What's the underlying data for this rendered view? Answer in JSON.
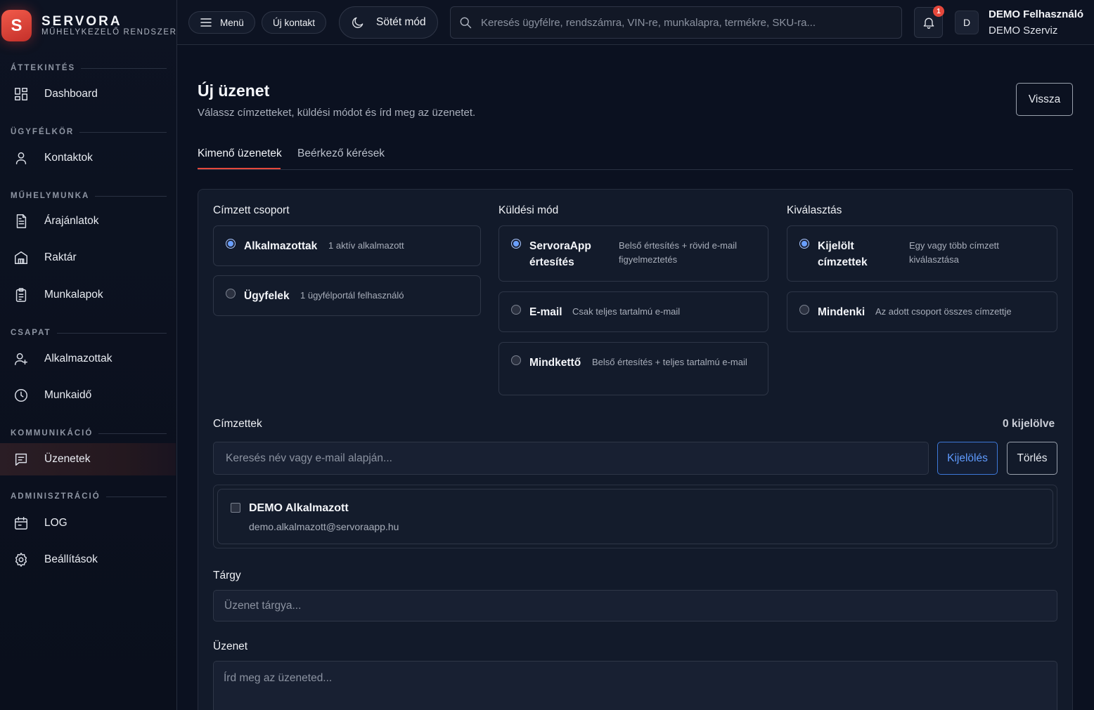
{
  "brand": {
    "logo_letter": "S",
    "name": "SERVORA",
    "subtitle": "MŰHELYKEZELŐ RENDSZER"
  },
  "sidebar": {
    "sections": [
      {
        "label": "ÁTTEKINTÉS",
        "items": [
          {
            "label": "Dashboard",
            "icon": "dashboard-icon"
          }
        ]
      },
      {
        "label": "ÜGYFÉLKÖR",
        "items": [
          {
            "label": "Kontaktok",
            "icon": "user-icon"
          }
        ]
      },
      {
        "label": "MŰHELYMUNKA",
        "items": [
          {
            "label": "Árajánlatok",
            "icon": "document-icon"
          },
          {
            "label": "Raktár",
            "icon": "warehouse-icon"
          },
          {
            "label": "Munkalapok",
            "icon": "clipboard-icon"
          }
        ]
      },
      {
        "label": "CSAPAT",
        "items": [
          {
            "label": "Alkalmazottak",
            "icon": "user-add-icon"
          },
          {
            "label": "Munkaidő",
            "icon": "clock-icon"
          }
        ]
      },
      {
        "label": "KOMMUNIKÁCIÓ",
        "items": [
          {
            "label": "Üzenetek",
            "icon": "message-icon",
            "active": true
          }
        ]
      },
      {
        "label": "ADMINISZTRÁCIÓ",
        "items": [
          {
            "label": "LOG",
            "icon": "calendar-icon"
          },
          {
            "label": "Beállítások",
            "icon": "gear-icon"
          }
        ]
      }
    ]
  },
  "topbar": {
    "menu_label": "Menü",
    "new_contact_label": "Új kontakt",
    "dark_mode_label": "Sötét mód",
    "search_placeholder": "Keresés ügyfélre, rendszámra, VIN-re, munkalapra, termékre, SKU-ra...",
    "notification_count": "1",
    "avatar_letter": "D",
    "user_name": "DEMO Felhasználó",
    "user_org": "DEMO Szerviz"
  },
  "page": {
    "title": "Új üzenet",
    "subtitle": "Válassz címzetteket, küldési módot és írd meg az üzenetet.",
    "back_label": "Vissza",
    "tabs": [
      {
        "label": "Kimenő üzenetek",
        "active": true
      },
      {
        "label": "Beérkező kérések",
        "active": false
      }
    ]
  },
  "form": {
    "recipient_group": {
      "label": "Címzett csoport",
      "options": [
        {
          "title": "Alkalmazottak",
          "desc": "1 aktív alkalmazott",
          "selected": true
        },
        {
          "title": "Ügyfelek",
          "desc": "1 ügyfélportál felhasználó",
          "selected": false
        }
      ]
    },
    "send_mode": {
      "label": "Küldési mód",
      "options": [
        {
          "title": "ServoraApp értesítés",
          "desc": "Belső értesítés + rövid e-mail figyelmeztetés",
          "selected": true
        },
        {
          "title": "E-mail",
          "desc": "Csak teljes tartalmú e-mail",
          "selected": false
        },
        {
          "title": "Mindkettő",
          "desc": "Belső értesítés + teljes tartalmú e-mail",
          "selected": false
        }
      ]
    },
    "selection": {
      "label": "Kiválasztás",
      "options": [
        {
          "title": "Kijelölt címzettek",
          "desc": "Egy vagy több címzett kiválasztása",
          "selected": true
        },
        {
          "title": "Mindenki",
          "desc": "Az adott csoport összes címzettje",
          "selected": false
        }
      ]
    },
    "recipients": {
      "label": "Címzettek",
      "count_label": "0 kijelölve",
      "search_placeholder": "Keresés név vagy e-mail alapján...",
      "select_label": "Kijelölés",
      "clear_label": "Törlés",
      "list": [
        {
          "name": "DEMO Alkalmazott",
          "email": "demo.alkalmazott@servoraapp.hu",
          "checked": false
        }
      ]
    },
    "subject": {
      "label": "Tárgy",
      "placeholder": "Üzenet tárgya..."
    },
    "message": {
      "label": "Üzenet",
      "placeholder": "Írd meg az üzeneted..."
    }
  },
  "colors": {
    "accent": "#e5483c",
    "link_blue": "#5f9bff",
    "background": "#0b1120"
  }
}
